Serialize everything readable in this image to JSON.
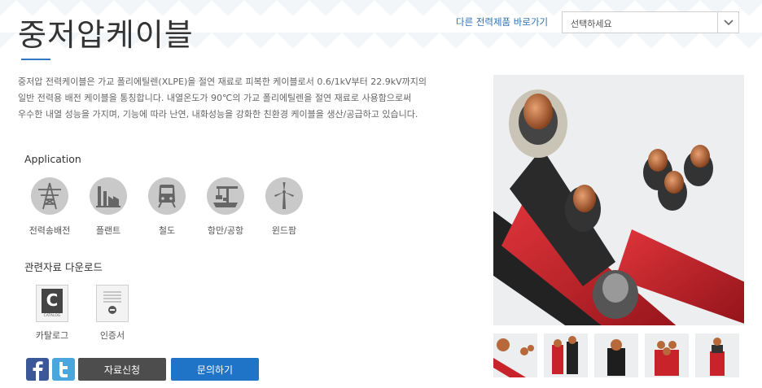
{
  "page": {
    "title": "중저압케이블"
  },
  "nav": {
    "other_label": "다른 전력제품 바로가기",
    "select_value": "선택하세요"
  },
  "description": [
    "중저압 전력케이블은 가교 폴리에틸렌(XLPE)을 절연 재료로 피복한 케이블로서 0.6/1kV부터 22.9kV까지의",
    "일반 전력용 배전 케이블을 통칭합니다. 내열온도가 90℃의 가교 폴리에틸렌을 절연 재료로 사용함으로써",
    "우수한 내열 성능을 가지며, 기능에 따라 난연, 내화성능을 강화한 친환경 케이블을 생산/공급하고 있습니다."
  ],
  "application": {
    "title": "Application",
    "items": [
      {
        "label": "전력송배전",
        "icon": "power-tower-icon"
      },
      {
        "label": "플랜트",
        "icon": "factory-icon"
      },
      {
        "label": "철도",
        "icon": "train-icon"
      },
      {
        "label": "항만/공항",
        "icon": "port-crane-icon"
      },
      {
        "label": "윈드팜",
        "icon": "wind-turbine-icon"
      }
    ]
  },
  "downloads": {
    "title": "관련자료 다운로드",
    "items": [
      {
        "label": "카탈로그",
        "icon": "catalog-icon",
        "badge_letter": "C",
        "badge_text": "CATALOG"
      },
      {
        "label": "인증서",
        "icon": "certificate-icon"
      }
    ]
  },
  "actions": {
    "request_label": "자료신청",
    "inquiry_label": "문의하기"
  },
  "colors": {
    "accent": "#1f74c8",
    "dark_button": "#4d4d4d",
    "icon_gray": "#c9c9c9",
    "cable_red": "#c8222a",
    "copper": "#b8693a"
  }
}
